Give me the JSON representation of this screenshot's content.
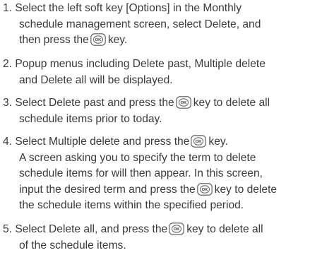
{
  "steps": [
    {
      "lines": [
        "1. Select the left soft key [Options] in the Monthly",
        "schedule management screen, select Delete, and",
        "then press the",
        "key."
      ]
    },
    {
      "lines": [
        "2. Popup menus including Delete past, Multiple delete",
        "and Delete all will be displayed."
      ]
    },
    {
      "lines": [
        "3. Select Delete past and press the",
        "key to delete all",
        "schedule items prior to today."
      ]
    },
    {
      "lines": [
        "4. Select Multiple delete and press the",
        "key.",
        "A screen asking you to specify the term to delete",
        "schedule items for will then appear. In this screen,",
        "input the desired term and press the",
        "key to delete",
        "the schedule items within the specified period."
      ]
    },
    {
      "lines": [
        "5. Select Delete all, and press the",
        "key to delete all",
        "of the schedule items."
      ]
    }
  ],
  "ok_key": {
    "icon": "ok-key-icon",
    "label": "OK"
  }
}
